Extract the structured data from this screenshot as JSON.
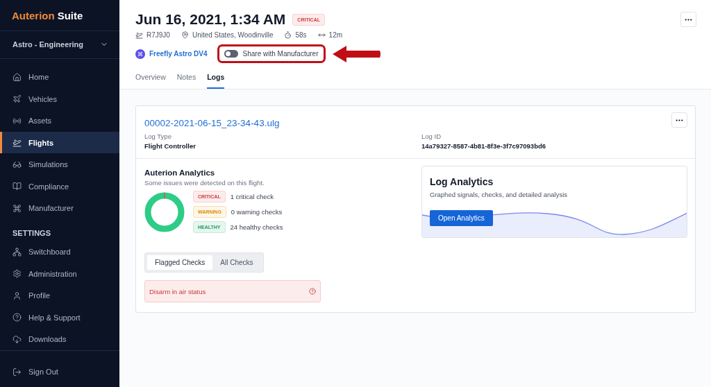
{
  "sidebar": {
    "logo": {
      "brand": "Auterion",
      "product": "Suite"
    },
    "org": "Astro - Engineering",
    "items": [
      {
        "label": "Home",
        "selected": false
      },
      {
        "label": "Vehicles",
        "selected": false
      },
      {
        "label": "Assets",
        "selected": false
      },
      {
        "label": "Flights",
        "selected": true
      },
      {
        "label": "Simulations",
        "selected": false
      },
      {
        "label": "Compliance",
        "selected": false
      },
      {
        "label": "Manufacturer",
        "selected": false
      }
    ],
    "settings_heading": "SETTINGS",
    "settings_items": [
      {
        "label": "Switchboard",
        "selected": false
      },
      {
        "label": "Administration",
        "selected": false
      },
      {
        "label": "Profile",
        "selected": false
      },
      {
        "label": "Help & Support",
        "selected": false
      },
      {
        "label": "Downloads",
        "selected": false
      }
    ],
    "sign_out": "Sign Out"
  },
  "header": {
    "title": "Jun 16, 2021, 1:34 AM",
    "status": "CRITICAL",
    "meta": [
      {
        "kind": "vehicle",
        "text": "R7J9J0"
      },
      {
        "kind": "location",
        "text": "United States, Woodinville"
      },
      {
        "kind": "duration",
        "text": "58s"
      },
      {
        "kind": "distance",
        "text": "12m"
      }
    ],
    "vehicle_link": "Freefly Astro DV4",
    "share_toggle": {
      "label": "Share with Manufacturer",
      "on": false
    },
    "tabs": [
      {
        "label": "Overview",
        "selected": false
      },
      {
        "label": "Notes",
        "selected": false
      },
      {
        "label": "Logs",
        "selected": true
      }
    ]
  },
  "log": {
    "file": "00002-2021-06-15_23-34-43.ulg",
    "fields": [
      {
        "label": "Log Type",
        "value": "Flight Controller"
      },
      {
        "label": "Log ID",
        "value": "14a79327-8587-4b81-8f3e-3f7c97093bd6"
      }
    ],
    "analytics": {
      "title": "Auterion Analytics",
      "subtitle": "Some issues were detected on this flight.",
      "checks": [
        {
          "kind": "critical",
          "badge": "CRITICAL",
          "text": "1 critical check"
        },
        {
          "kind": "warning",
          "badge": "WARNING",
          "text": "0 warning checks"
        },
        {
          "kind": "healthy",
          "badge": "HEALTHY",
          "text": "24 healthy checks"
        }
      ],
      "check_tabs": [
        {
          "label": "Flagged Checks",
          "selected": true
        },
        {
          "label": "All Checks",
          "selected": false
        }
      ],
      "flagged": [
        {
          "text": "Disarm in air status"
        }
      ]
    },
    "log_analytics": {
      "title": "Log Analytics",
      "subtitle": "Graphed signals, checks, and detailed analysis",
      "button": "Open Analytics"
    }
  }
}
